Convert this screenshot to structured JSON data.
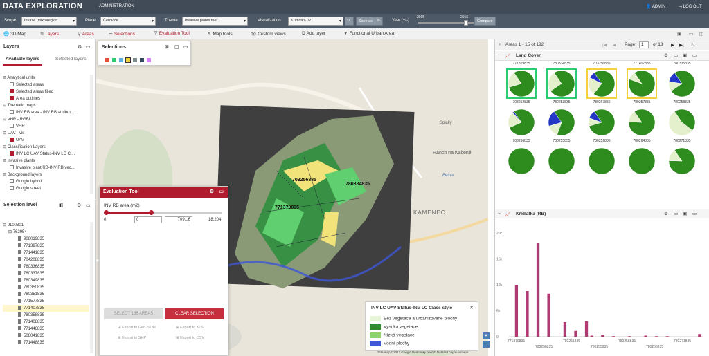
{
  "header": {
    "title": "DATA EXPLORATION",
    "admin": "ADMINISTRATION",
    "user": "ADMIN",
    "logout": "LOG OUT"
  },
  "filters": {
    "scope_label": "Scope",
    "scope_value": "Invaze (mikroregion",
    "place_label": "Place",
    "place_value": "Čeřovice",
    "theme_label": "Theme",
    "theme_value": "Invasive plants ther",
    "viz_label": "Visualization",
    "viz_value": "Křídlatka 02",
    "save_as": "Save as",
    "year_label": "Year (+/-)",
    "year_from": "2015",
    "year_to": "2016",
    "compare": "Compare"
  },
  "toolbar": [
    "3D Map",
    "Layers",
    "Areas",
    "Selections",
    "Evaluation Tool",
    "Map tools",
    "Custom views",
    "Add layer",
    "Functional Urban Area"
  ],
  "layers": {
    "title": "Layers",
    "tab_available": "Available layers",
    "tab_selected": "Selected layers",
    "tree": [
      {
        "label": "Analytical units",
        "type": "folder",
        "indent": 0
      },
      {
        "label": "Selected areas",
        "type": "check",
        "checked": false,
        "indent": 1
      },
      {
        "label": "Selected areas filled",
        "type": "check",
        "checked": true,
        "indent": 1
      },
      {
        "label": "Area outlines",
        "type": "check",
        "checked": true,
        "indent": 1
      },
      {
        "label": "Thematic maps",
        "type": "folder",
        "indent": 0
      },
      {
        "label": "INV RB area - INV RB attribut...",
        "type": "check",
        "checked": false,
        "indent": 1
      },
      {
        "label": "VHR - RGBI",
        "type": "folder",
        "indent": 0
      },
      {
        "label": "VHR",
        "type": "check",
        "checked": false,
        "indent": 1
      },
      {
        "label": "UAV - vis",
        "type": "folder",
        "indent": 0
      },
      {
        "label": "UAV",
        "type": "check",
        "checked": true,
        "indent": 1
      },
      {
        "label": "Classification Layers",
        "type": "folder",
        "indent": 0
      },
      {
        "label": "INV LC UAV Status-INV LC Cl...",
        "type": "check",
        "checked": true,
        "indent": 1
      },
      {
        "label": "Invasive plants",
        "type": "folder",
        "indent": 0
      },
      {
        "label": "Invasive plant RB-INV RB vec...",
        "type": "check",
        "checked": false,
        "indent": 1
      },
      {
        "label": "Background layers",
        "type": "folder",
        "indent": 0
      },
      {
        "label": "Google hybrid",
        "type": "check",
        "checked": false,
        "indent": 1
      },
      {
        "label": "Google street",
        "type": "check",
        "checked": false,
        "indent": 1
      }
    ]
  },
  "selection_level": {
    "title": "Selection level",
    "root": "9100301",
    "sub": "762954",
    "items": [
      "908019835",
      "771397835",
      "771441835",
      "704208835",
      "780336835",
      "780337835",
      "780349835",
      "780350835",
      "780351835",
      "771577835",
      "771407835",
      "780358835",
      "771408835",
      "771446835",
      "508041835",
      "771448835"
    ],
    "highlight": "771407835"
  },
  "selections": {
    "title": "Selections",
    "colors": [
      "#e84c3d",
      "#2ecc71",
      "#5dade2",
      "#f4d03f",
      "#7f8c8d",
      "#34495e",
      "#d783ff"
    ]
  },
  "evaluation": {
    "title": "Evaluation Tool",
    "attr_label": "INV RB area (m2)",
    "min": "0",
    "max": "18,204",
    "from": "0",
    "to": "7091.6",
    "select_btn": "SELECT 186 AREAS",
    "clear_btn": "CLEAR SELECTION",
    "export": [
      "Export to GeoJSON",
      "Export to XLS",
      "Export to SHP",
      "Export to CSV"
    ]
  },
  "map": {
    "labels": [
      "703256835",
      "780334835",
      "771379835"
    ],
    "places": [
      "Ranch na Kačeně",
      "KAMENEC",
      "Bečva",
      "Spicky"
    ],
    "attribution": "Data map ©2017 Google   Podmínky použití   Nahlásit chybu v mapě"
  },
  "legend": {
    "title": "INV LC UAV Status-INV LC Class style",
    "items": [
      {
        "label": "Bez vegetace a urbanizované plochy",
        "color": "#e6f4d7"
      },
      {
        "label": "Vysoká vegetace",
        "color": "#2e8b2e"
      },
      {
        "label": "Nízká vegetace",
        "color": "#8fd16a"
      },
      {
        "label": "Vodní plochy",
        "color": "#3f56d6"
      }
    ]
  },
  "right": {
    "areas_range": "Areas 1 - 15 of 192",
    "page_label": "Page",
    "page": "1",
    "of_pages": "of 13",
    "land_cover_title": "Land Cover",
    "kridlatka_title": "Křídlatka (RB)"
  },
  "pies": [
    {
      "label": "771379835",
      "slices": [
        0.8,
        0.2,
        0
      ],
      "sel": "#2ecc71"
    },
    {
      "label": "780334835",
      "slices": [
        0.75,
        0.25,
        0
      ],
      "sel": "#2ecc71"
    },
    {
      "label": "703256835",
      "slices": [
        0.7,
        0.22,
        0.08
      ],
      "sel": "#f4d03f"
    },
    {
      "label": "771407835",
      "slices": [
        0.9,
        0.1,
        0
      ],
      "sel": "#f4d03f"
    },
    {
      "label": "780335835",
      "slices": [
        0.75,
        0.12,
        0.13
      ],
      "sel": null
    },
    {
      "label": "703252835",
      "slices": [
        0.78,
        0.2,
        0.02
      ],
      "sel": null
    },
    {
      "label": "780253835",
      "slices": [
        0.65,
        0.15,
        0.2
      ],
      "sel": null
    },
    {
      "label": "780267835",
      "slices": [
        0.8,
        0.1,
        0.1
      ],
      "sel": null
    },
    {
      "label": "780257835",
      "slices": [
        0.85,
        0.15,
        0
      ],
      "sel": null
    },
    {
      "label": "780258835",
      "slices": [
        0.45,
        0.55,
        0
      ],
      "sel": null
    },
    {
      "label": "703266835",
      "slices": [
        1,
        0,
        0
      ],
      "sel": null
    },
    {
      "label": "780255835",
      "slices": [
        1,
        0,
        0
      ],
      "sel": null
    },
    {
      "label": "780259835",
      "slices": [
        1,
        0,
        0
      ],
      "sel": null
    },
    {
      "label": "780264835",
      "slices": [
        1,
        0,
        0
      ],
      "sel": null
    },
    {
      "label": "780271835",
      "slices": [
        0.85,
        0.15,
        0
      ],
      "sel": null
    }
  ],
  "chart_data": {
    "type": "bar",
    "title": "Křídlatka (RB)",
    "categories": [
      "771379835",
      "703256835",
      "780251835",
      "780255835",
      "780258835",
      "780266835",
      "780271835"
    ],
    "values": [
      10000,
      8000,
      3000,
      1000,
      100,
      100,
      100
    ],
    "series_values": [
      0,
      10000,
      0,
      8800,
      0,
      18000,
      0,
      8300,
      0,
      0,
      2800,
      0,
      1100,
      0,
      3000,
      200,
      0,
      300,
      0,
      100,
      0,
      0,
      100,
      0,
      0,
      200,
      0,
      100,
      0,
      100,
      0,
      0,
      0,
      0,
      0,
      500
    ],
    "ylim": [
      0,
      20000
    ],
    "yticks": [
      "20k",
      "15k",
      "10k",
      "5k",
      "0"
    ],
    "color": "#b03a72"
  }
}
